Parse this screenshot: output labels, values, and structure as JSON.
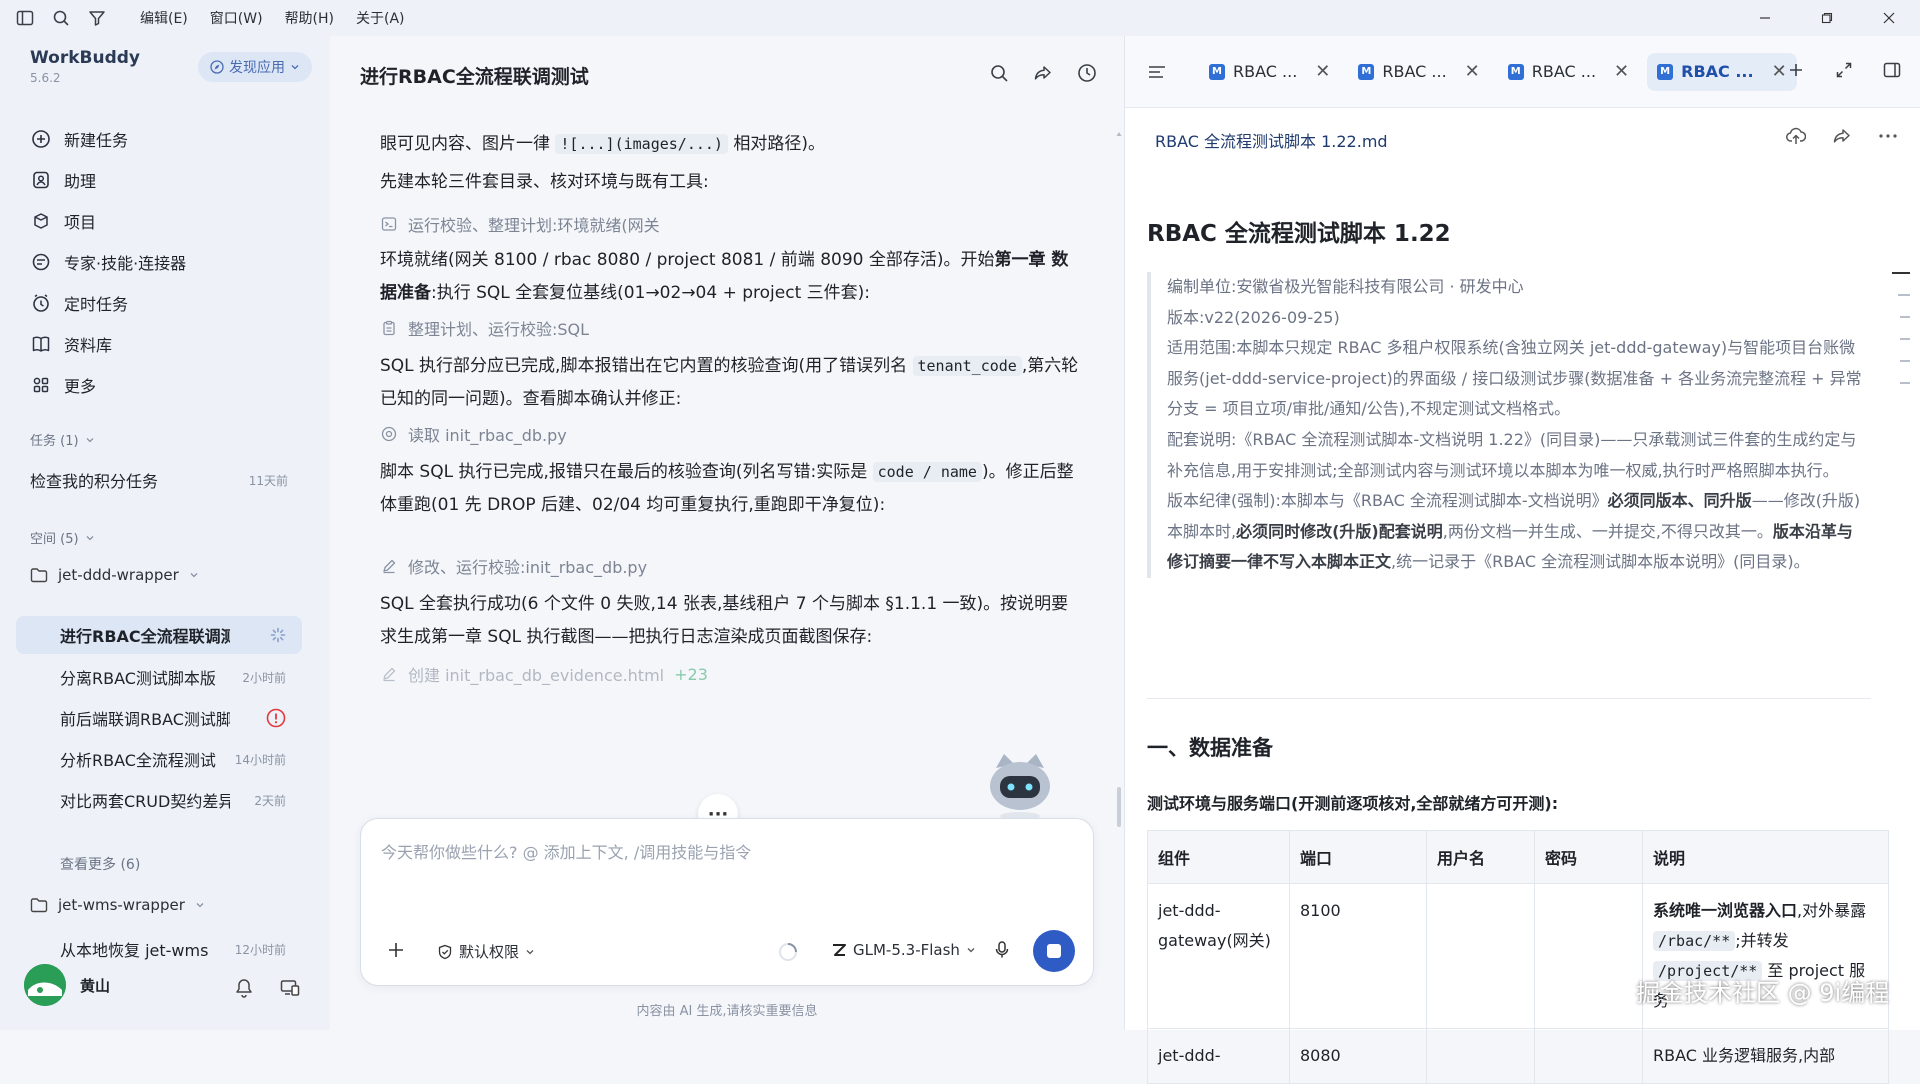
{
  "menu": [
    "编辑(E)",
    "窗口(W)",
    "帮助(H)",
    "关于(A)"
  ],
  "app": {
    "name": "WorkBuddy",
    "version": "5.6.2",
    "discover_label": "发现应用"
  },
  "nav": [
    {
      "label": "新建任务",
      "icon": "plus-circle-icon"
    },
    {
      "label": "助理",
      "icon": "assistant-icon"
    },
    {
      "label": "项目",
      "icon": "project-icon"
    },
    {
      "label": "专家·技能·连接器",
      "icon": "expert-icon"
    },
    {
      "label": "定时任务",
      "icon": "clock-icon"
    },
    {
      "label": "资料库",
      "icon": "book-icon"
    },
    {
      "label": "更多",
      "icon": "grid-icon"
    }
  ],
  "tasks_section": {
    "title": "任务 (1)",
    "items": [
      {
        "title": "检查我的积分任务",
        "time": "11天前"
      }
    ]
  },
  "spaces_section": {
    "title": "空间 (5)",
    "projects": [
      {
        "name": "jet-ddd-wrapper",
        "subs": [
          {
            "title": "进行RBAC全流程联调测试",
            "time": ""
          },
          {
            "title": "分离RBAC测试脚本版",
            "time": "2小时前"
          },
          {
            "title": "前后端联调RBAC测试脚本",
            "time": ""
          },
          {
            "title": "分析RBAC全流程测试",
            "time": "14小时前"
          },
          {
            "title": "对比两套CRUD契约差异",
            "time": "2天前"
          }
        ],
        "more": "查看更多 (6)"
      },
      {
        "name": "jet-wms-wrapper",
        "subs": [
          {
            "title": "从本地恢复 jet-wms",
            "time": "12小时前"
          }
        ]
      }
    ]
  },
  "user": {
    "name": "黄山"
  },
  "chat": {
    "title": "进行RBAC全流程联调测试",
    "m1_a": "眼可见内容、图片一律 ",
    "m1_code": "![...](images/...)",
    "m1_b": " 相对路径)。",
    "m2": "先建本轮三件套目录、核对环境与既有工具:",
    "s1": "运行校验、整理计划:环境就绪(网关",
    "m3_a": "环境就绪(网关 8100 / rbac 8080 / project 8081 / 前端 8090 全部存活)。开始",
    "m3_b": "第一章 数据准备",
    "m3_c": ":执行 SQL 全套复位基线(01→02→04 + project 三件套):",
    "s2": "整理计划、运行校验:SQL",
    "m4_a": "SQL 执行部分应已完成,脚本报错出在它内置的核验查询(用了错误列名 ",
    "m4_code": "tenant_code",
    "m4_b": ",第六轮已知的同一问题)。查看脚本确认并修正:",
    "s3": "读取 init_rbac_db.py",
    "m5_a": "脚本 SQL 执行已完成,报错只在最后的核验查询(列名写错:实际是 ",
    "m5_code": "code / name",
    "m5_b": ")。修正后整体重跑(01 先 DROP 后建、02/04 均可重复执行,重跑即干净复位):",
    "s4": "修改、运行校验:init_rbac_db.py",
    "m6": "SQL 全套执行成功(6 个文件 0 失败,14 张表,基线租户 7 个与脚本 §1.1.1 一致)。按说明要求生成第一章 SQL 执行截图——把执行日志渲染成页面截图保存:",
    "s5": "创建 init_rbac_db_evidence.html",
    "s5_count": "+23",
    "placeholder": "今天帮你做些什么? @ 添加上下文, /调用技能与指令",
    "perm_label": "默认权限",
    "model": "GLM-5.3-Flash",
    "disclaimer": "内容由 AI 生成,请核实重要信息"
  },
  "doc": {
    "tabs": [
      "RBAC ...",
      "RBAC ...",
      "RBAC ...",
      "RBAC ..."
    ],
    "file": "RBAC 全流程测试脚本 1.22.md",
    "h1": "RBAC 全流程测试脚本 1.22",
    "q1": "编制单位:安徽省极光智能科技有限公司 · 研发中心",
    "q2": "版本:v22(2026-09-25)",
    "q3": "适用范围:本脚本只规定 RBAC 多租户权限系统(含独立网关 jet-ddd-gateway)与智能项目台账微服务(jet-ddd-service-project)的界面级 / 接口级测试步骤(数据准备 + 各业务流完整流程 + 异常分支 = 项目立项/审批/通知/公告),不规定测试文档格式。",
    "q4": "配套说明:《RBAC 全流程测试脚本-文档说明 1.22》(同目录)——只承载测试三件套的生成约定与补充信息,用于安排测试;全部测试内容与测试环境以本脚本为唯一权威,执行时严格照脚本执行。",
    "q5_a": "版本纪律(强制):本脚本与《RBAC 全流程测试脚本-文档说明》",
    "q5_b": "必须同版本、同升版",
    "q5_c": "——修改(升版)本脚本时,",
    "q5_d": "必须同时修改(升版)配套说明",
    "q5_e": ",两份文档一并生成、一并提交,不得只改其一。",
    "q5_f": "版本沿革与修订摘要一律不写入本脚本正文",
    "q5_g": ",统一记录于《RBAC 全流程测试脚本版本说明》(同目录)。",
    "h2": "一、数据准备",
    "h4": "测试环境与服务端口(开测前逐项核对,全部就绪方可开测):",
    "table": {
      "headers": [
        "组件",
        "端口",
        "用户名",
        "密码",
        "说明"
      ],
      "r1": {
        "c1": "jet-ddd-gateway(网关)",
        "c2": "8100",
        "c5_a": "系统唯一浏览器入口",
        "c5_b": ",对外暴露 ",
        "c5_code1": "/rbac/**",
        "c5_c": ";并转发 ",
        "c5_code2": "/project/**",
        "c5_d": " 至 project 服务"
      },
      "r2": {
        "c1": "jet-ddd-",
        "c2": "8080",
        "c5": "RBAC 业务逻辑服务,内部"
      }
    }
  },
  "watermark": "掘金技术社区 @ 9i编程"
}
